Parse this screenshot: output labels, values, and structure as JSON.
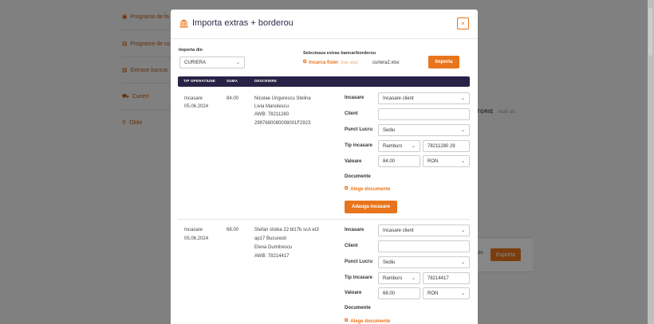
{
  "background": {
    "sidebar_items": [
      {
        "label": "Programe de fa",
        "icon": "calendar-icon"
      },
      {
        "label": "Programe de co",
        "icon": "document-icon"
      },
      {
        "label": "Extrase bancar",
        "icon": "bank-card-icon"
      },
      {
        "label": "Curieri",
        "icon": "truck-icon"
      },
      {
        "label": "Oblie",
        "icon": "tag-icon"
      }
    ],
    "brand_text": "TORIE",
    "brand_sub": "multi afc",
    "card_label": "de",
    "export_button": "Exporta"
  },
  "modal": {
    "title": "Importa extras + borderou",
    "close_icon": "×",
    "import_from_label": "Importa din",
    "import_from_value": "CURIERA",
    "select_file_label": "Selecteaza extras bancar/borderou",
    "upload_link": "Incarca fisier",
    "upload_hint": "(csv, xlsx)",
    "file_name": "curiera2.xlsx",
    "import_button": "Importa",
    "table_headers": [
      "TIP OPERATIUNE",
      "SUMA",
      "DESCRIERE"
    ],
    "form_labels": {
      "incasare": "Incasare",
      "client": "Client",
      "punct_lucru": "Punct Lucru",
      "tip_incasare": "Tip incasare",
      "valoare": "Valoare",
      "documente": "Documente"
    },
    "rows": [
      {
        "type_line1": "Incasare",
        "type_line2": "05.06.2024",
        "amount": "84.00",
        "desc": [
          "Nicolae Ungurescu Stelina",
          "Livia Manolescu",
          "AWB: 78211280",
          "2997680080008001F2923"
        ],
        "incasare_select": "Incasare client",
        "client_value": "",
        "punct_lucru_select": "Sediu",
        "tip_incasare_select": "Ramburs",
        "tip_incasare_ref": "78211280 29",
        "valoare": "84.00",
        "currency": "RON",
        "choose_docs": "Alege documente",
        "add_button": "Adauga Incasare"
      },
      {
        "type_line1": "Incasare",
        "type_line2": "05.06.2024",
        "amount": "68.00",
        "desc": [
          "Stefan stoika 22 bl17b scA et3",
          "ap17 Bucuresti",
          "Elena Dumitrescu",
          "AWB: 78214417"
        ],
        "incasare_select": "Incasare client",
        "client_value": "",
        "punct_lucru_select": "Sediu",
        "tip_incasare_select": "Ramburs",
        "tip_incasare_ref": "78214417",
        "valoare": "68.00",
        "currency": "RON",
        "choose_docs": "Alege documente"
      }
    ]
  },
  "colors": {
    "accent": "#e8741c",
    "table_header": "#272346",
    "title": "#2e2a4a"
  }
}
